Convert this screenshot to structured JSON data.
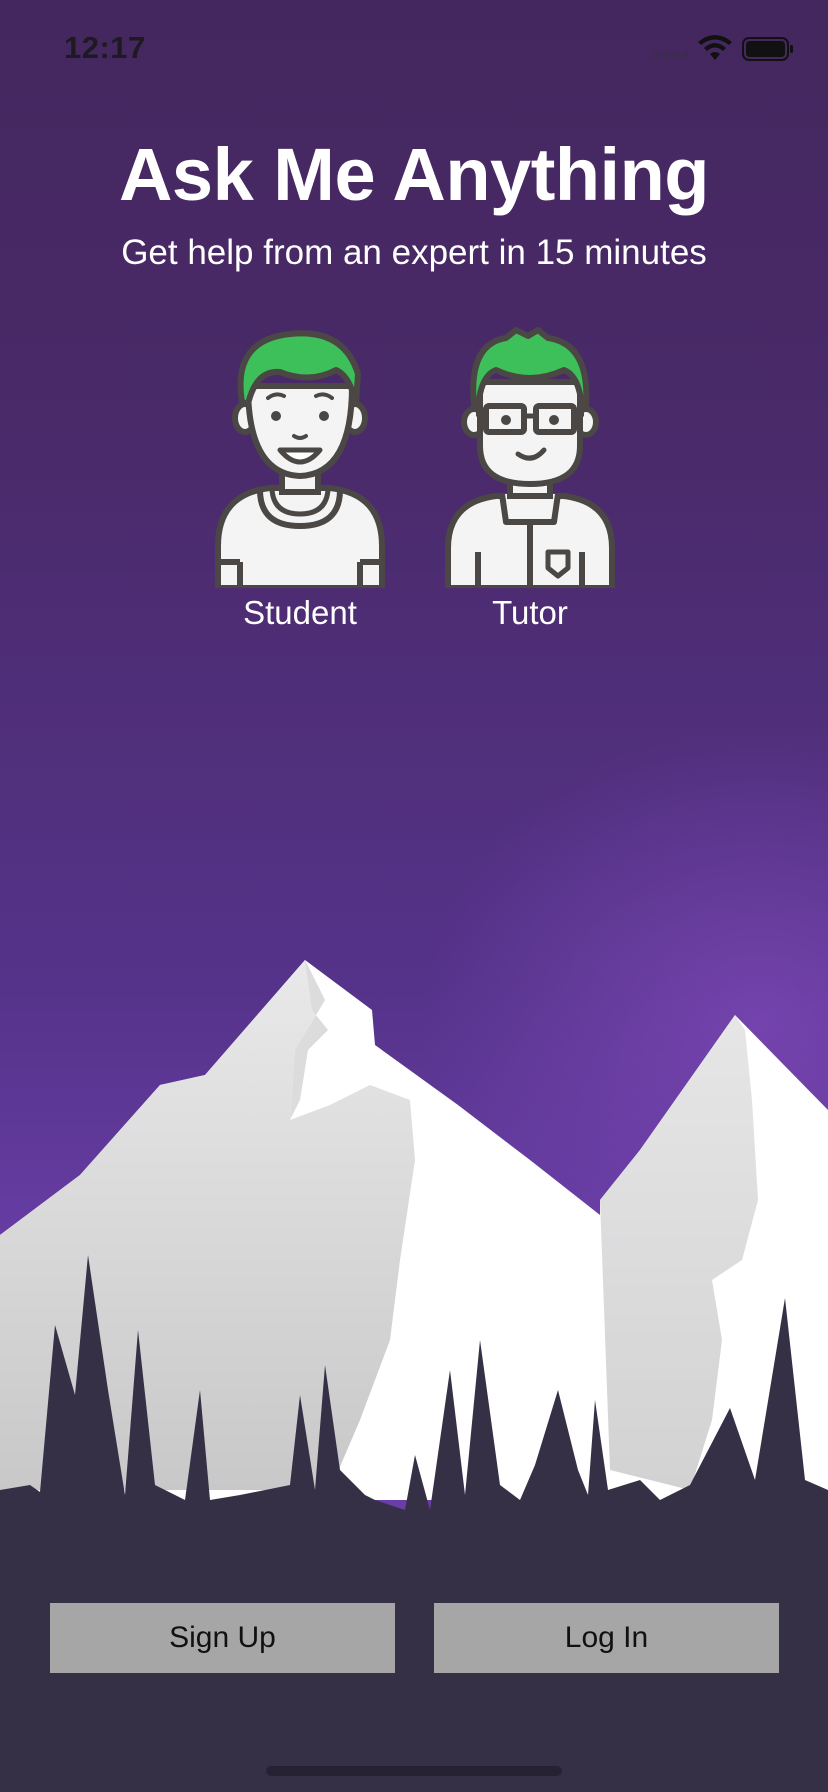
{
  "status_bar": {
    "time": "12:17",
    "icons": [
      "signal-icon",
      "wifi-icon",
      "battery-icon"
    ]
  },
  "header": {
    "title": "Ask Me Anything",
    "subtitle": "Get help from an expert in 15 minutes"
  },
  "roles": [
    {
      "label": "Student",
      "icon": "student-avatar-icon"
    },
    {
      "label": "Tutor",
      "icon": "tutor-avatar-icon"
    }
  ],
  "actions": {
    "signup_label": "Sign Up",
    "login_label": "Log In"
  },
  "colors": {
    "background_top": "#44275e",
    "background_bottom": "#6a3ea8",
    "ground": "#353046",
    "button": "#a6a6a6",
    "hair": "#3dbf5a"
  }
}
